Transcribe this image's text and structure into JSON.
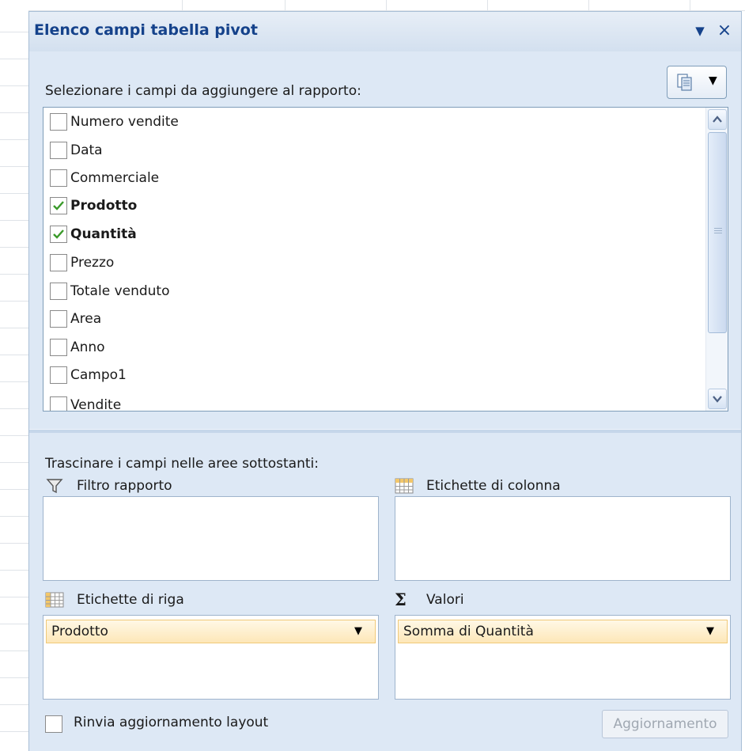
{
  "pane": {
    "title": "Elenco campi tabella pivot",
    "choose_fields_prompt": "Selezionare i campi da aggiungere al rapporto:",
    "drag_prompt": "Trascinare i campi nelle aree sottostanti:"
  },
  "fields": [
    {
      "label": "Numero vendite",
      "checked": false
    },
    {
      "label": "Data",
      "checked": false
    },
    {
      "label": "Commerciale",
      "checked": false
    },
    {
      "label": "Prodotto",
      "checked": true
    },
    {
      "label": "Quantità",
      "checked": true
    },
    {
      "label": "Prezzo",
      "checked": false
    },
    {
      "label": "Totale venduto",
      "checked": false
    },
    {
      "label": "Area",
      "checked": false
    },
    {
      "label": "Anno",
      "checked": false
    },
    {
      "label": "Campo1",
      "checked": false
    },
    {
      "label": "Vendite",
      "checked": false
    }
  ],
  "areas": {
    "report_filter": {
      "label": "Filtro rapporto",
      "icon": "filter-icon"
    },
    "column_labels": {
      "label": "Etichette di colonna",
      "icon": "column-grid-icon"
    },
    "row_labels": {
      "label": "Etichette di riga",
      "icon": "row-grid-icon",
      "item": "Prodotto"
    },
    "values": {
      "label": "Valori",
      "icon": "sigma-icon",
      "item": "Somma di Quantità"
    }
  },
  "footer": {
    "defer_label": "Rinvia aggiornamento layout",
    "defer_checked": false,
    "update_label": "Aggiornamento"
  },
  "colors": {
    "title": "#15428b",
    "pane_bg": "#dde8f5",
    "chip_bg": "#fde7b8",
    "check": "#3a9a2a"
  }
}
